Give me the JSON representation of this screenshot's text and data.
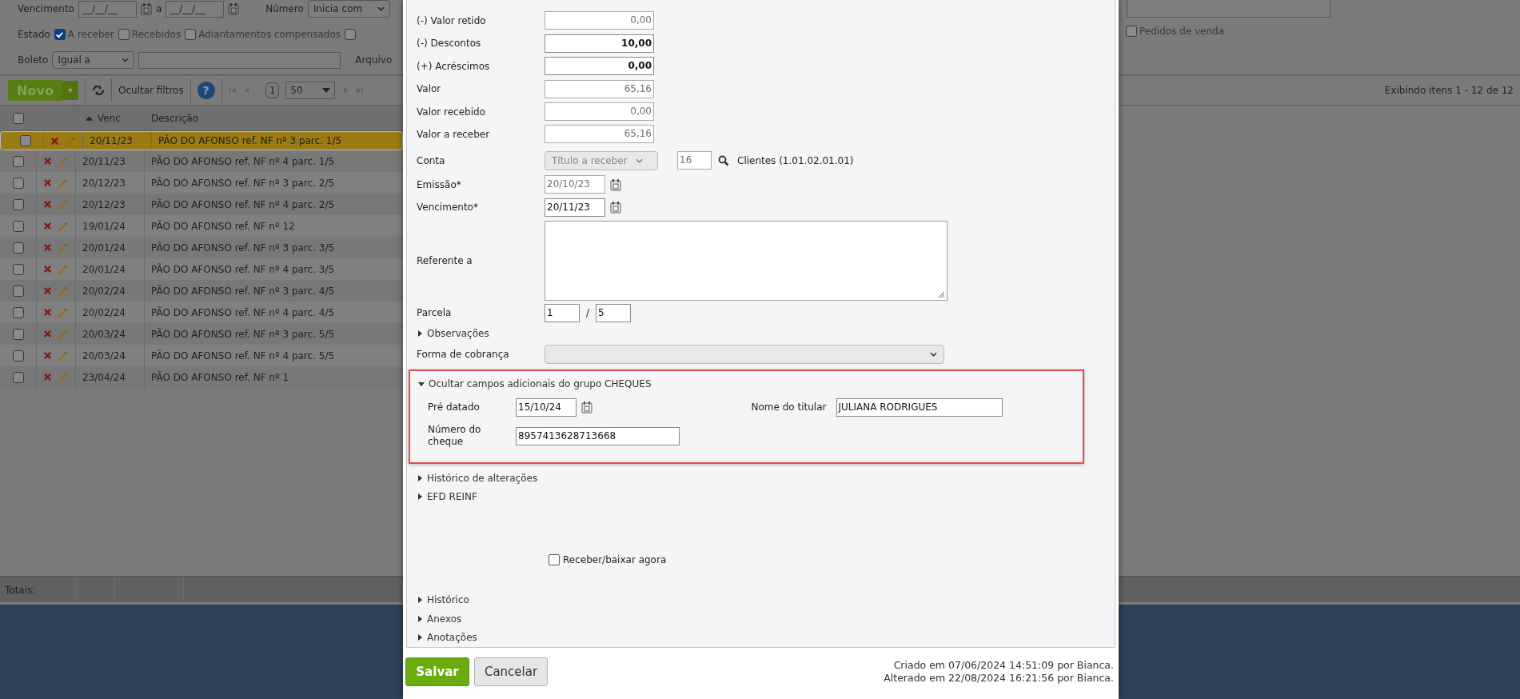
{
  "filters": {
    "vencimento": {
      "label": "Vencimento",
      "from": "__/__/__",
      "separator": "a",
      "to": "__/__/__"
    },
    "numero": {
      "label": "Número",
      "mode": "Inicia com"
    },
    "estado": {
      "label": "Estado",
      "options": [
        {
          "label": "A receber",
          "checked": true
        },
        {
          "label": "Recebidos",
          "checked": false
        },
        {
          "label": "Adiantamentos compensados",
          "checked": false
        },
        {
          "checked": false
        }
      ]
    },
    "pedidos": {
      "label": "Pedidos de venda",
      "checked": false
    },
    "boleto": {
      "label": "Boleto",
      "mode": "Igual a"
    },
    "arquivo_label": "Arquivo"
  },
  "toolbar": {
    "new_button": "Novo",
    "hide_filters": "Ocultar filtros",
    "help": "?",
    "page": "1",
    "page_size": "50",
    "summary": "Exibindo itens 1 - 12 de 12"
  },
  "table": {
    "columns": [
      "Venc",
      "Descrição"
    ],
    "select_all": false,
    "rows": [
      {
        "venc": "20/11/23",
        "descricao": "PÃO DO AFONSO ref. NF nº 3 parc. 1/5",
        "selected": true,
        "checked": false
      },
      {
        "venc": "20/11/23",
        "descricao": "PÃO DO AFONSO ref. NF nº 4 parc. 1/5",
        "selected": false,
        "checked": false
      },
      {
        "venc": "20/12/23",
        "descricao": "PÃO DO AFONSO ref. NF nº 3 parc. 2/5",
        "selected": false,
        "checked": false
      },
      {
        "venc": "20/12/23",
        "descricao": "PÃO DO AFONSO ref. NF nº 4 parc. 2/5",
        "selected": false,
        "checked": false
      },
      {
        "venc": "19/01/24",
        "descricao": "PÃO DO AFONSO ref. NF nº 12",
        "selected": false,
        "checked": false
      },
      {
        "venc": "20/01/24",
        "descricao": "PÃO DO AFONSO ref. NF nº 3 parc. 3/5",
        "selected": false,
        "checked": false
      },
      {
        "venc": "20/01/24",
        "descricao": "PÃO DO AFONSO ref. NF nº 4 parc. 3/5",
        "selected": false,
        "checked": false
      },
      {
        "venc": "20/02/24",
        "descricao": "PÃO DO AFONSO ref. NF nº 3 parc. 4/5",
        "selected": false,
        "checked": false
      },
      {
        "venc": "20/02/24",
        "descricao": "PÃO DO AFONSO ref. NF nº 4 parc. 4/5",
        "selected": false,
        "checked": false
      },
      {
        "venc": "20/03/24",
        "descricao": "PÃO DO AFONSO ref. NF nº 3 parc. 5/5",
        "selected": false,
        "checked": false
      },
      {
        "venc": "20/03/24",
        "descricao": "PÃO DO AFONSO ref. NF nº 4 parc. 5/5",
        "selected": false,
        "checked": false
      },
      {
        "venc": "23/04/24",
        "descricao": "PÃO DO AFONSO ref. NF nº 1",
        "selected": false,
        "checked": false
      }
    ]
  },
  "totals_label": "Totais:",
  "form": {
    "fields": [
      {
        "label": "(-) Valor retido",
        "value": "0,00",
        "readonly": true
      },
      {
        "label": "(-) Descontos",
        "value": "10,00",
        "readonly": false
      },
      {
        "label": "(+) Acréscimos",
        "value": "0,00",
        "readonly": false
      },
      {
        "label": "Valor",
        "value": "65,16",
        "readonly": true
      },
      {
        "label": "Valor recebido",
        "value": "0,00",
        "readonly": true
      },
      {
        "label": "Valor a receber",
        "value": "65,16",
        "readonly": true
      }
    ],
    "conta": {
      "label": "Conta",
      "account_type": "Título a receber",
      "code": "16",
      "account_name": "Clientes (1.01.02.01.01)"
    },
    "dates": [
      {
        "label": "Emissão*",
        "value": "20/10/23",
        "readonly": true
      },
      {
        "label": "Vencimento*",
        "value": "20/11/23",
        "readonly": false
      }
    ],
    "referente": {
      "label": "Referente a"
    },
    "parcela": {
      "label": "Parcela",
      "number": "1",
      "separator": "/",
      "total": "5"
    },
    "observacoes": {
      "label": "Observações",
      "expanded": false
    },
    "forma_cobranca": {
      "label": "Forma de cobrança"
    },
    "cheques": {
      "title": "Ocultar campos adicionais do grupo CHEQUES",
      "expanded": true,
      "pre_datado": {
        "label": "Pré datado",
        "value": "15/10/24"
      },
      "numero_cheque": {
        "label": "Número do cheque",
        "value": "8957413628713668"
      },
      "titular": {
        "label": "Nome do titular",
        "value": "JULIANA RODRIGUES"
      }
    },
    "sections_a": [
      {
        "label": "Histórico de alterações",
        "expanded": false
      },
      {
        "label": "EFD REINF",
        "expanded": false
      }
    ],
    "receber_agora": {
      "label": "Receber/baixar agora",
      "checked": false
    },
    "sections_b": [
      {
        "label": "Histórico",
        "expanded": false
      },
      {
        "label": "Anexos",
        "expanded": false
      },
      {
        "label": "Anotações",
        "expanded": false
      }
    ]
  },
  "footer": {
    "save": "Salvar",
    "cancel": "Cancelar",
    "created": "Criado em 07/06/2024 14:51:09 por Bianca.",
    "changed": "Alterado em 22/08/2024 16:21:56 por Bianca."
  }
}
